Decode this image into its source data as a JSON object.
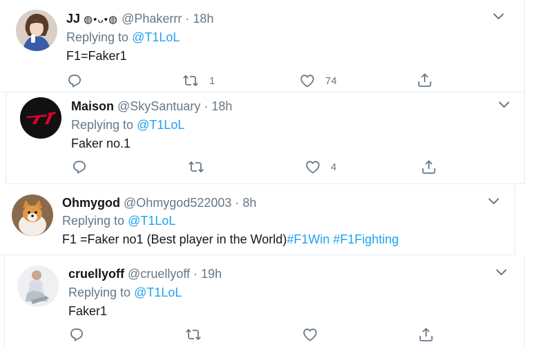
{
  "colors": {
    "link": "#1da1f2",
    "muted": "#657786",
    "text": "#14171a",
    "border": "#e6ecf0"
  },
  "tweets": [
    {
      "name": "JJ",
      "name_emoji": "◍•ᴗ•◍",
      "handle": "@Phakerrr",
      "separator": "·",
      "time": "18h",
      "replying_prefix": "Replying to",
      "replying_to": "@T1LoL",
      "text": "F1=Faker1",
      "hashtags": "",
      "retweets": "1",
      "likes": "74",
      "avatar_icon": "user-photo-avatar"
    },
    {
      "name": "Maison",
      "handle": "@SkySantuary",
      "separator": "·",
      "time": "18h",
      "replying_prefix": "Replying to",
      "replying_to": "@T1LoL",
      "text": "Faker no.1",
      "hashtags": "",
      "retweets": "",
      "likes": "4",
      "avatar_icon": "t1-logo-avatar"
    },
    {
      "name": "Ohmygod",
      "handle": "@Ohmygod522003",
      "separator": "·",
      "time": "8h",
      "replying_prefix": "Replying to",
      "replying_to": "@T1LoL",
      "text": "F1 =Faker no1 (Best player in the World)",
      "hashtags": "#F1Win #F1Fighting",
      "retweets": "",
      "likes": "",
      "avatar_icon": "dog-photo-avatar"
    },
    {
      "name": "cruellyoff",
      "handle": "@cruellyoff",
      "separator": "·",
      "time": "19h",
      "replying_prefix": "Replying to",
      "replying_to": "@T1LoL",
      "text": "Faker1",
      "hashtags": "",
      "retweets": "",
      "likes": "",
      "avatar_icon": "person-photo-avatar"
    }
  ]
}
